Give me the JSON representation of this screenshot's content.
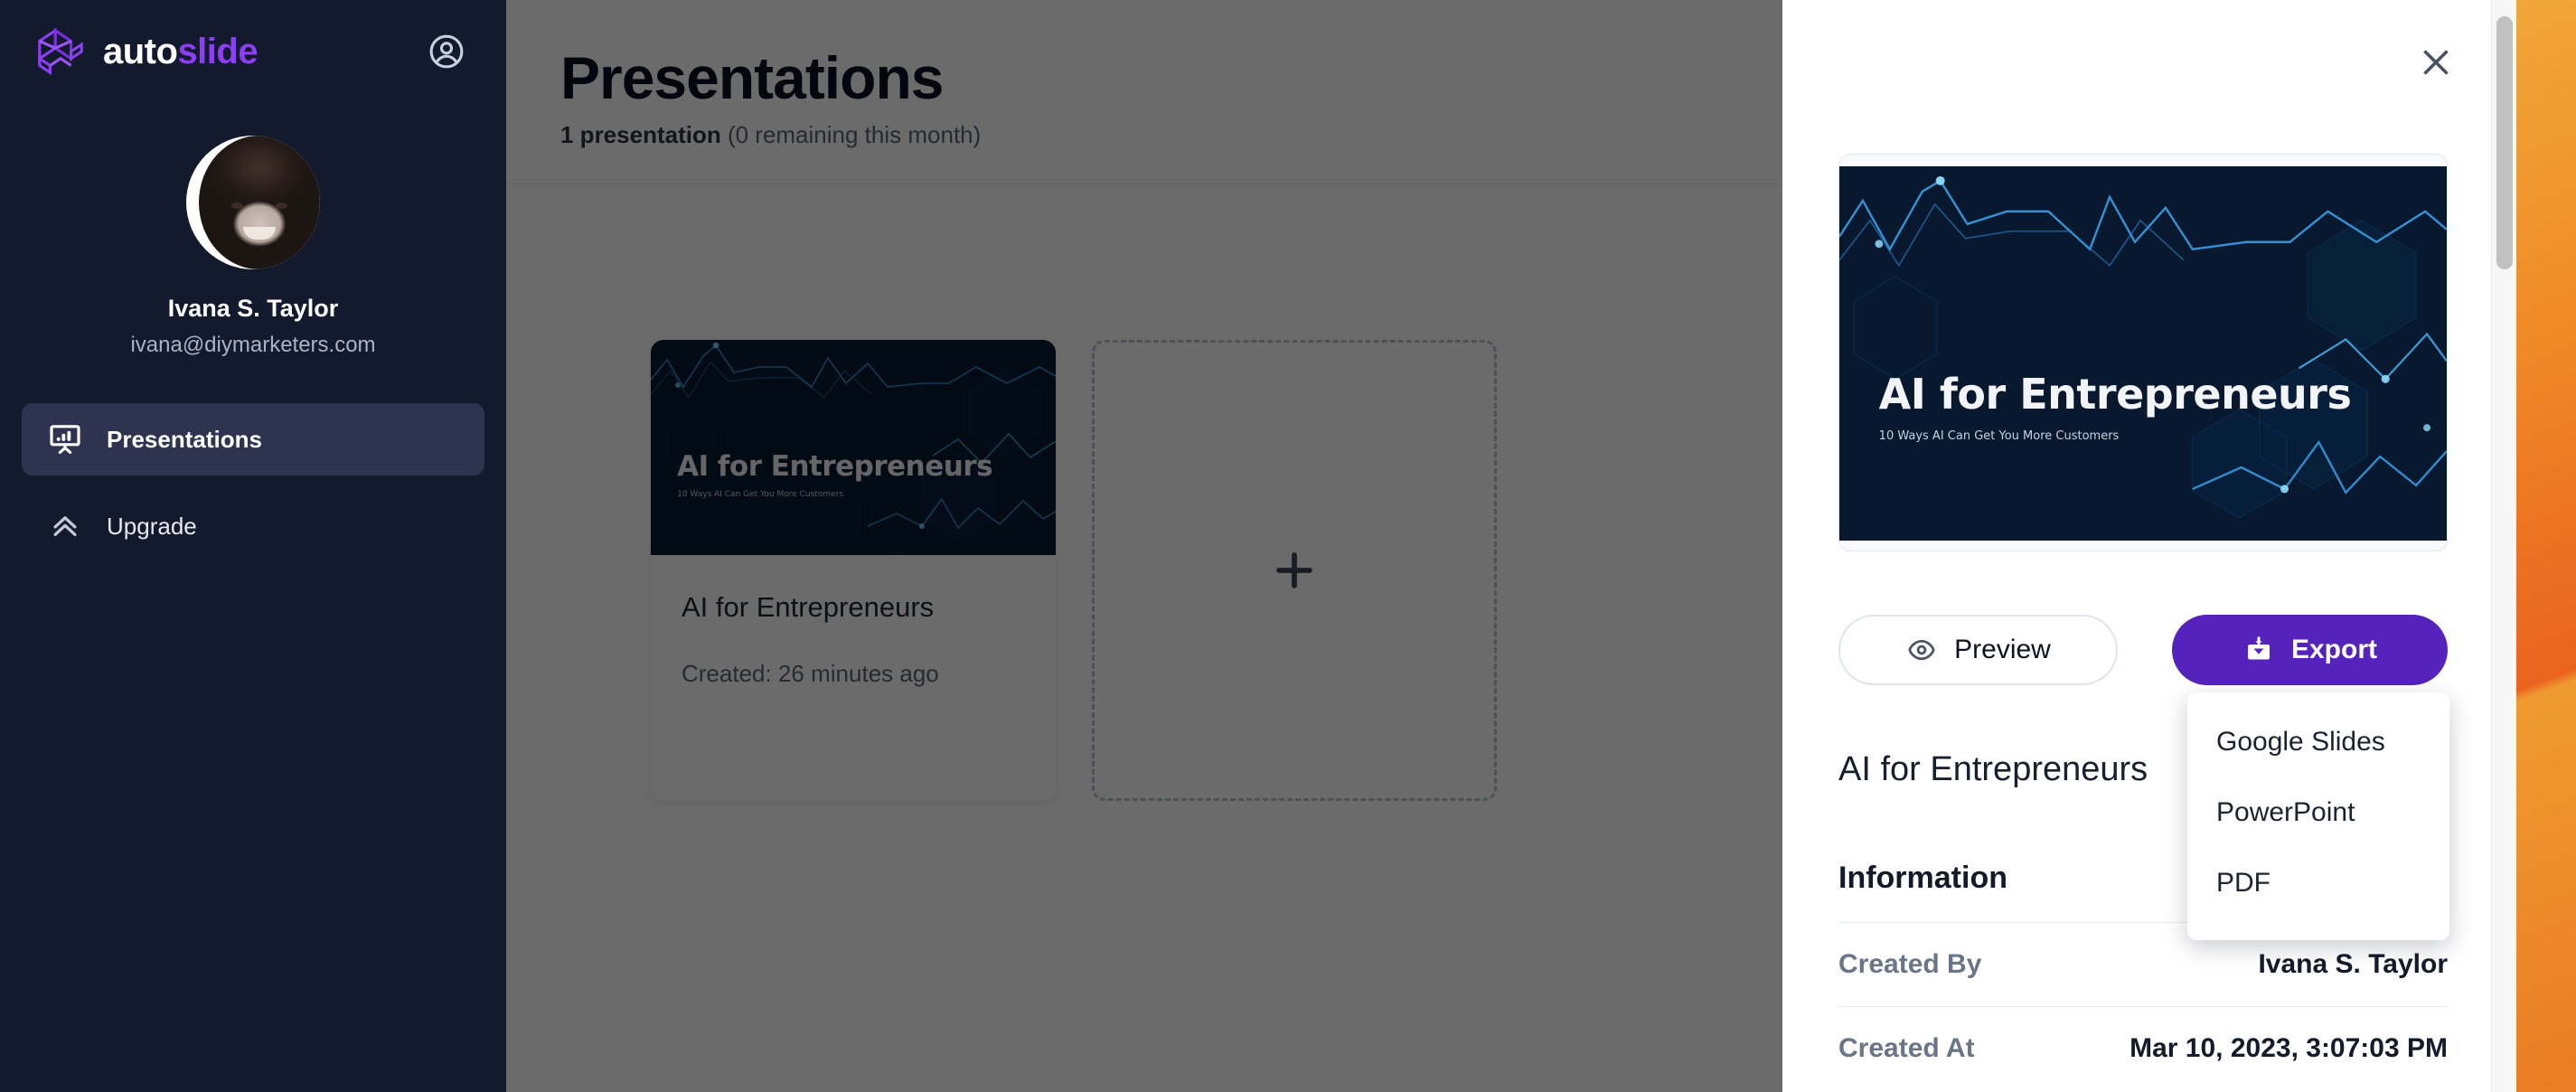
{
  "brand": {
    "name_part1": "auto",
    "name_part2": "slide",
    "logo_icon": "autoslide-cube-logo",
    "account_icon": "account-circle-icon",
    "accent_color": "#8b3ff0"
  },
  "sidebar": {
    "profile": {
      "name": "Ivana S. Taylor",
      "email": "ivana@diymarketers.com",
      "avatar_icon": "user-avatar-photo"
    },
    "nav_items": [
      {
        "label": "Presentations",
        "icon": "presentation-board-icon",
        "active": true
      },
      {
        "label": "Upgrade",
        "icon": "double-chevron-up-icon",
        "active": false
      }
    ]
  },
  "main": {
    "title": "Presentations",
    "subtitle_bold": "1 presentation",
    "subtitle_rest": " (0 remaining this month)",
    "cards": [
      {
        "title": "AI for Entrepreneurs",
        "meta_label": "Created:",
        "meta_value": "26 minutes ago",
        "slide_heading": "AI for Entrepreneurs",
        "slide_subheading": "10 Ways AI Can Get You More Customers"
      }
    ],
    "add_card": {
      "icon": "plus-icon",
      "label": ""
    }
  },
  "drawer": {
    "close_icon": "close-x-icon",
    "slide_preview": {
      "heading": "AI for Entrepreneurs",
      "subheading": "10 Ways AI Can Get You More Customers"
    },
    "buttons": {
      "preview": {
        "label": "Preview",
        "icon": "eye-icon"
      },
      "export": {
        "label": "Export",
        "icon": "download-box-icon",
        "color": "#5522bb"
      }
    },
    "export_menu": {
      "items": [
        "Google Slides",
        "PowerPoint",
        "PDF"
      ]
    },
    "title": "AI for Entrepreneurs",
    "information_heading": "Information",
    "info_rows": [
      {
        "label": "Created By",
        "value": "Ivana S. Taylor"
      },
      {
        "label": "Created At",
        "value": "Mar 10, 2023, 3:07:03 PM"
      }
    ]
  },
  "scrollbar": {
    "name": "vertical-scrollbar"
  }
}
